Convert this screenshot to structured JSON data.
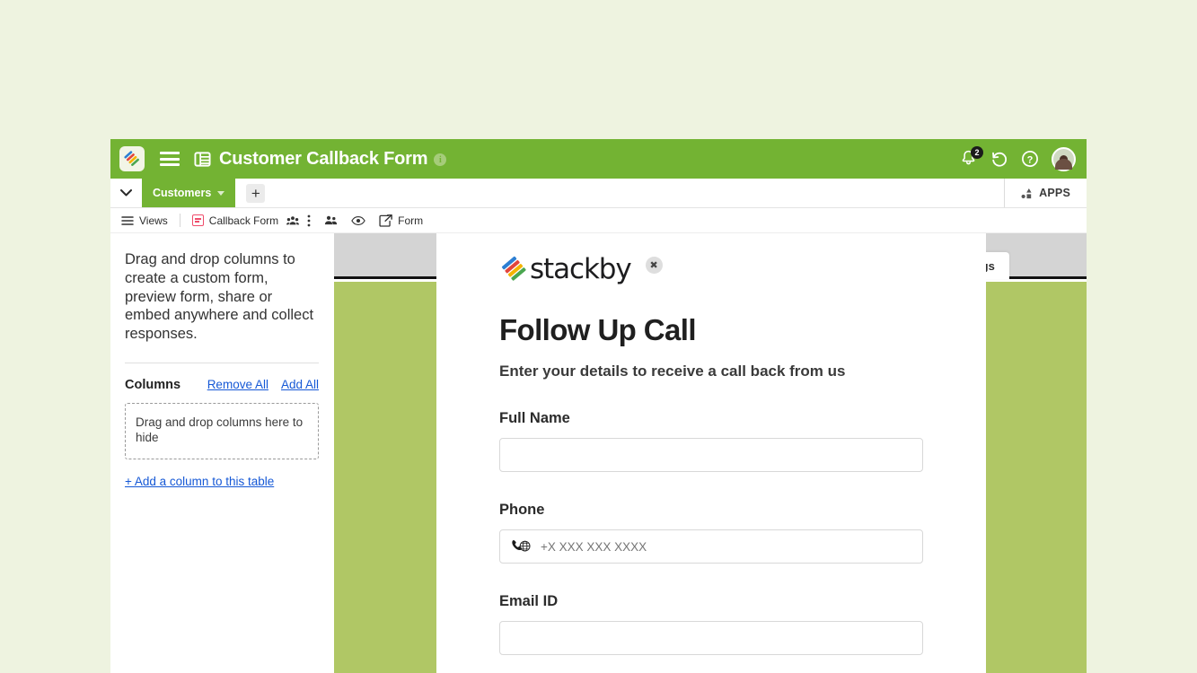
{
  "header": {
    "app_logo_icon": "stackby-logo-icon",
    "menu_icon": "hamburger-menu-icon",
    "grid_icon": "table-grid-icon",
    "title": "Customer Callback Form",
    "info_icon": "info-icon",
    "notification_icon": "bell-icon",
    "notification_count": "2",
    "history_icon": "history-revert-icon",
    "help_icon": "question-mark-help-icon",
    "avatar_icon": "user-avatar"
  },
  "tabstrip": {
    "expand_icon": "chevron-down-icon",
    "active_tab": "Customers",
    "tab_caret_icon": "caret-down-icon",
    "add_tab_label": "+",
    "apps_label": "APPS",
    "apps_icon": "apps-icon"
  },
  "viewbar": {
    "views_icon": "list-views-icon",
    "views_label": "Views",
    "form_icon": "form-view-icon",
    "view_name": "Callback Form",
    "group_icon": "group-people-icon",
    "more_icon": "more-vertical-icon",
    "collaborators_icon": "collaborators-icon",
    "preview_icon": "eye-preview-icon",
    "share_icon": "share-external-icon",
    "share_label": "Form"
  },
  "background": {
    "settings_tab_label": "n Settings",
    "grey_color": "#d4d4d4",
    "olive_color": "#b0c765",
    "page_bg_color": "#eef3e0",
    "brand_green": "#73b333"
  },
  "left_panel": {
    "intro": "Drag and drop columns to create a custom form, preview form, share or embed anywhere and collect responses.",
    "columns_label": "Columns",
    "remove_all_label": "Remove All",
    "add_all_label": "Add All",
    "dropzone_text": "Drag and drop columns here to hide",
    "add_column_label": "+ Add a column to this table",
    "link_color": "#1558d6"
  },
  "form": {
    "logo_word": "stackby",
    "logo_icon": "stackby-brand-logo",
    "close_icon": "close-x-icon",
    "title": "Follow Up Call",
    "subtitle": "Enter your details to receive a call back from us",
    "fields": [
      {
        "label": "Full Name",
        "value": "",
        "placeholder": "",
        "icon": ""
      },
      {
        "label": "Phone",
        "value": "",
        "placeholder": "+X XXX XXX XXXX",
        "icon": "phone-globe-icon"
      },
      {
        "label": "Email ID",
        "value": "",
        "placeholder": "",
        "icon": ""
      }
    ]
  }
}
